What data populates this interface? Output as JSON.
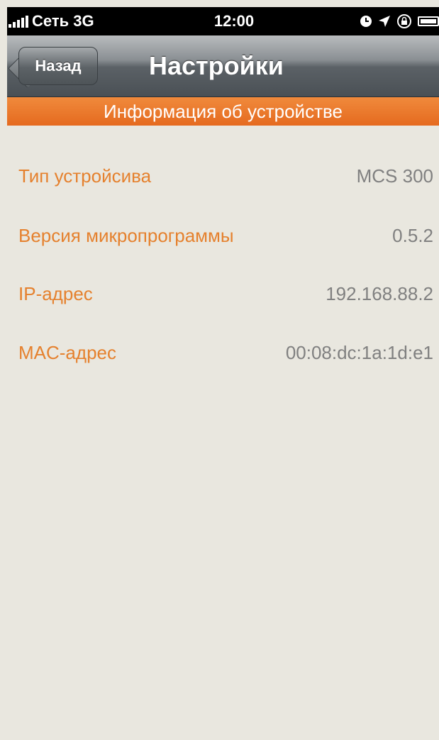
{
  "status_bar": {
    "carrier": "Сеть 3G",
    "time": "12:00",
    "icons": [
      "signal-bars-icon",
      "clock-icon",
      "location-arrow-icon",
      "rotation-lock-icon",
      "battery-icon"
    ]
  },
  "nav_bar": {
    "back_label": "Назад",
    "title": "Настройки"
  },
  "section": {
    "header": "Информация об устройстве"
  },
  "info": [
    {
      "label": "Тип устройсива",
      "value": "MCS 300"
    },
    {
      "label": "Версия микропрограммы",
      "value": "0.5.2"
    },
    {
      "label": "IP-адрес",
      "value": "192.168.88.2"
    },
    {
      "label": "MAC-адрес",
      "value": "00:08:dc:1a:1d:e1"
    }
  ],
  "colors": {
    "accent": "#e5812e",
    "header_orange": "#ea7328",
    "background": "#e9e7df",
    "value_gray": "#808080"
  }
}
